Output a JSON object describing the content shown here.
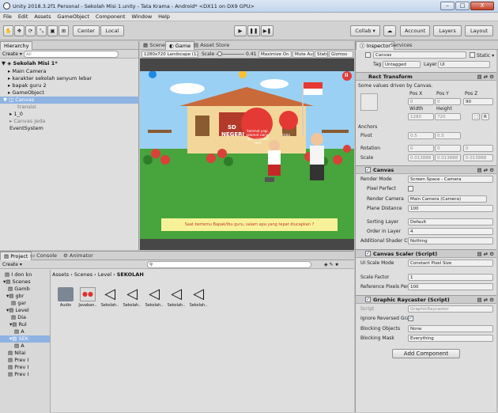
{
  "window": {
    "title": "Unity 2018.3.2f1 Personal - Sekolah Misi 1.unity - Tata Krama - Android* <DX11 on DX9 GPU>",
    "min": "–",
    "max": "□",
    "close": "X"
  },
  "menu": [
    "File",
    "Edit",
    "Assets",
    "GameObject",
    "Component",
    "Window",
    "Help"
  ],
  "toolbar": {
    "center": "Center",
    "local": "Local",
    "collab": "Collab ▾",
    "account": "Account",
    "layers": "Layers",
    "layout": "Layout"
  },
  "hierarchy": {
    "tab": "Hierarchy",
    "create": "Create ▾",
    "search": "All",
    "scene": "Sekolah Misi 1*",
    "items": [
      "Main Camera",
      "karakter sekolah senyum lebar",
      "bapak guru 2",
      "GameObject",
      "Canvas",
      "transisi",
      "1_0",
      "Canvas Jeda",
      "EventSystem"
    ]
  },
  "sceneTabs": {
    "scene": "Scene",
    "game": "Game",
    "store": "Asset Store"
  },
  "gameBar": {
    "aspect": "1280x720 Landscape (128)",
    "scale_label": "Scale",
    "scale_value": "0.41",
    "maximize": "Maximize On Play",
    "mute": "Mute Audio",
    "stats": "Stats",
    "gizmos": "Gizmos"
  },
  "game": {
    "sign_line1": "SD",
    "sign_line2": "NEGERI",
    "bubble1": "Selamat pagi, selamat siang, atau selamat sore",
    "bubble2": "Halo",
    "dialog": "Saat bertemu Bapak/Ibu guru, salam apa yang tepat diucapkan ?"
  },
  "project": {
    "tab_project": "Project",
    "tab_console": "Console",
    "tab_animator": "Animator",
    "create": "Create ▾",
    "tree": [
      "I don kn",
      "Scenes",
      "Gamb",
      "gbr",
      "gar",
      "Level",
      "Dia",
      "Rul",
      "A",
      "SEK",
      "A",
      "Nilai",
      "Prev I",
      "Prev I",
      "Prev I"
    ],
    "breadcrumb": [
      "Assets",
      "Scenes",
      "Level",
      "SEKOLAH"
    ],
    "assets": [
      "Audio",
      "Javaban..",
      "Sekolah..",
      "Sekolah..",
      "Sekolah..",
      "Sekolah..",
      "Sekolah.."
    ]
  },
  "inspector": {
    "tab_inspector": "Inspector",
    "tab_services": "Services",
    "object_name": "Canvas",
    "static": "Static ▾",
    "tag_label": "Tag",
    "tag_value": "Untagged",
    "layer_label": "Layer",
    "layer_value": "UI",
    "rect": {
      "title": "Rect Transform",
      "note": "Some values driven by Canvas.",
      "posx": "Pos X",
      "posy": "Pos Y",
      "posz": "Pos Z",
      "vx": "0",
      "vy": "0",
      "vz": "90",
      "width": "Width",
      "height": "Height",
      "w": "1280",
      "h": "720",
      "anchors": "Anchors",
      "pivot": "Pivot",
      "px": "0.5",
      "py": "0.5",
      "rotation": "Rotation",
      "rx": "0",
      "ry": "0",
      "rz": "0",
      "scale": "Scale",
      "sx": "0.013888",
      "sy": "0.013888",
      "sz": "0.013888"
    },
    "canvas": {
      "title": "Canvas",
      "render_mode": "Render Mode",
      "render_mode_v": "Screen Space - Camera",
      "pixel_perfect": "Pixel Perfect",
      "render_camera": "Render Camera",
      "render_camera_v": "Main Camera (Camera)",
      "plane": "Plane Distance",
      "plane_v": "100",
      "sorting": "Sorting Layer",
      "sorting_v": "Default",
      "order": "Order in Layer",
      "order_v": "4",
      "additional": "Additional Shader Cha",
      "additional_v": "Nothing"
    },
    "scaler": {
      "title": "Canvas Scaler (Script)",
      "ui_scale": "UI Scale Mode",
      "ui_scale_v": "Constant Pixel Size",
      "factor": "Scale Factor",
      "factor_v": "1",
      "ref": "Reference Pixels Per U",
      "ref_v": "100"
    },
    "raycaster": {
      "title": "Graphic Raycaster (Script)",
      "script": "Script",
      "script_v": "GraphicRaycaster",
      "ignore": "Ignore Reversed Grap",
      "blocking_obj": "Blocking Objects",
      "blocking_obj_v": "None",
      "blocking_mask": "Blocking Mask",
      "blocking_mask_v": "Everything"
    },
    "add_component": "Add Component"
  },
  "colors": {
    "sky": "#9ad0f4",
    "grass": "#48a43c",
    "dialog": "#f7f29a",
    "selected": "#3d80d6"
  }
}
